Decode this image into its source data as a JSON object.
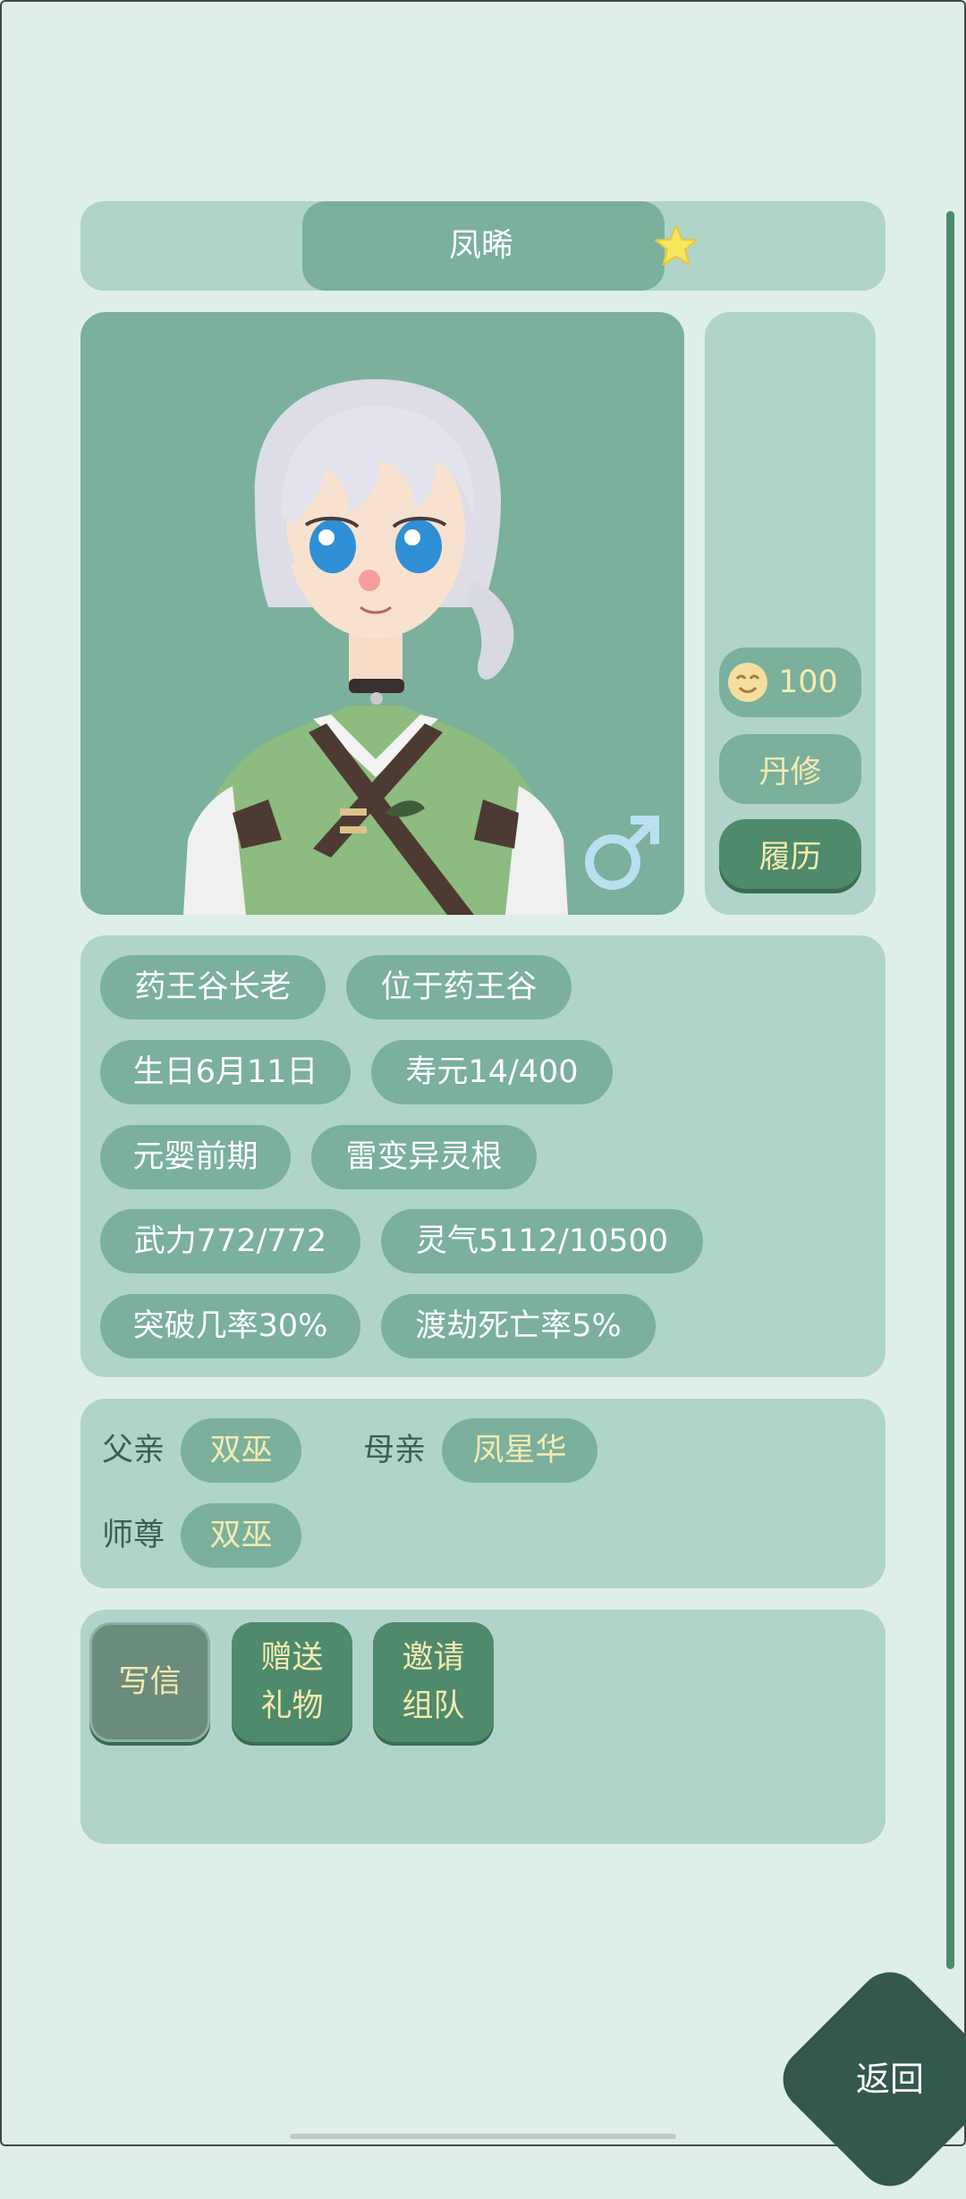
{
  "character": {
    "name": "凤晞"
  },
  "side": {
    "mood_value": "100",
    "profession": "丹修",
    "resume_label": "履历"
  },
  "stats": {
    "title": "药王谷长老",
    "location": "位于药王谷",
    "birthday": "生日6月11日",
    "lifespan": "寿元14/400",
    "realm": "元婴前期",
    "root": "雷变异灵根",
    "force": "武力772/772",
    "qi": "灵气5112/10500",
    "breakthrough": "突破几率30%",
    "tribulation": "渡劫死亡率5%"
  },
  "family": {
    "father_label": "父亲",
    "father_name": "双巫",
    "mother_label": "母亲",
    "mother_name": "凤星华",
    "master_label": "师尊",
    "master_name": "双巫"
  },
  "actions": {
    "write": "写信",
    "gift": "赠送礼物",
    "invite": "邀请组队"
  },
  "nav": {
    "back": "返回"
  },
  "colors": {
    "background": "#deefe9",
    "panel": "#b0d4c9",
    "tag": "#7ab09c",
    "dark_button": "#4e8a6b",
    "gold_text": "#f5eab0",
    "back_button": "#34584a"
  },
  "icons": {
    "favorite": "star-icon",
    "gender": "male-icon",
    "mood": "smiling-face-icon"
  }
}
